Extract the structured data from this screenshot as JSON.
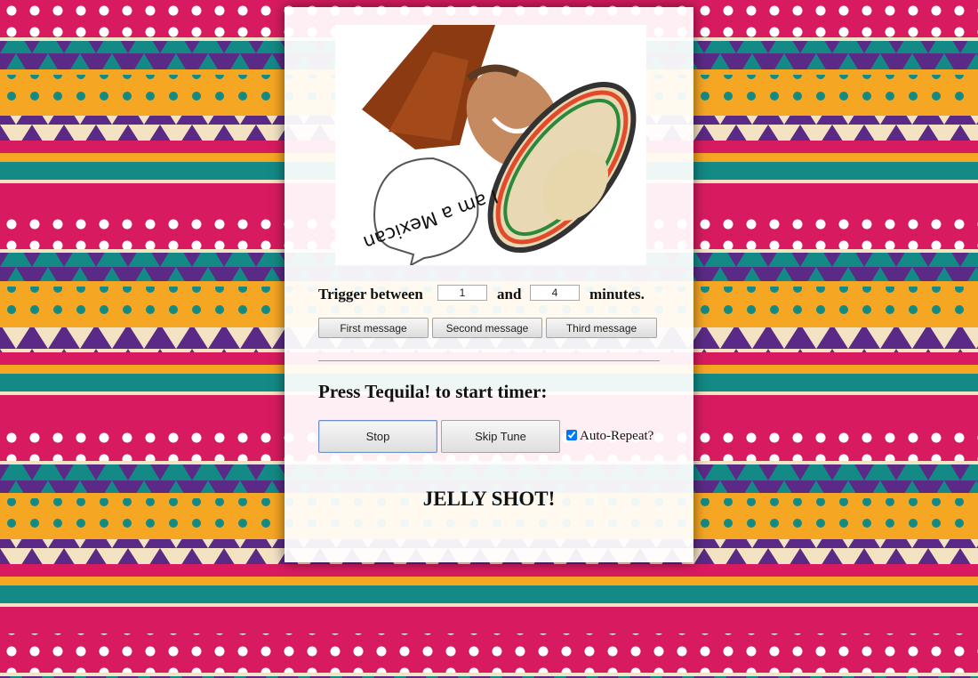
{
  "photo": {
    "speech_bubble_text": "I am a Mexican",
    "description_icon": "man-with-sombrero-upside-down"
  },
  "trigger": {
    "prefix": "Trigger between",
    "min_value": "1",
    "joiner": "and",
    "max_value": "4",
    "suffix": "minutes."
  },
  "messages": {
    "first": "First message",
    "second": "Second message",
    "third": "Third message"
  },
  "timer": {
    "heading": "Press Tequila! to start timer:",
    "stop_label": "Stop",
    "skip_label": "Skip Tune",
    "auto_repeat_label": "Auto-Repeat?",
    "auto_repeat_checked": true
  },
  "status": {
    "text": "JELLY SHOT!"
  },
  "colors": {
    "pink": "#d81b60",
    "orange": "#f5a623",
    "purple": "#5b2a86",
    "teal": "#138a86",
    "cream": "#f3e3c3"
  }
}
